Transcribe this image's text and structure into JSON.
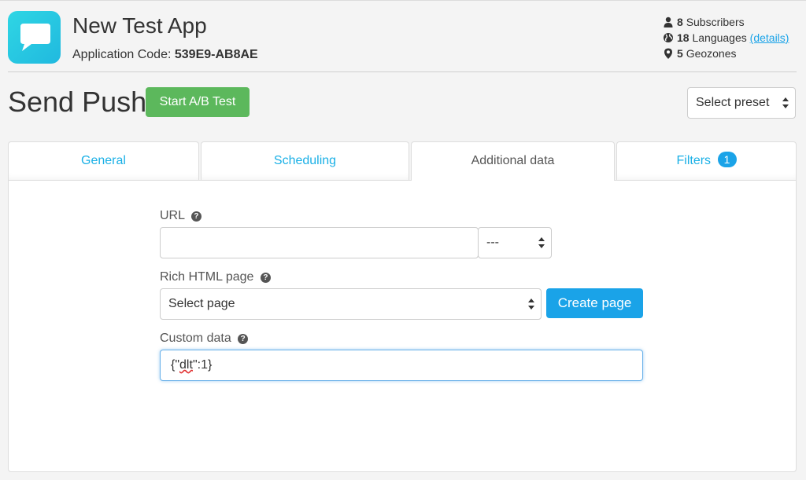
{
  "app": {
    "name": "New Test App",
    "code_label": "Application Code:",
    "code": "539E9-AB8AE",
    "icon": "chat-bubble-icon",
    "icon_color": "#22c1e2"
  },
  "stats": {
    "subscribers_count": "8",
    "subscribers_label": "Subscribers",
    "languages_count": "18",
    "languages_label": "Languages",
    "details_link": "(details)",
    "geozones_count": "5",
    "geozones_label": "Geozones"
  },
  "page": {
    "title": "Send Push",
    "ab_button": "Start A/B Test",
    "preset_select": "Select preset"
  },
  "tabs": [
    {
      "label": "General",
      "active": false
    },
    {
      "label": "Scheduling",
      "active": false
    },
    {
      "label": "Additional data",
      "active": true
    },
    {
      "label": "Filters",
      "active": false,
      "badge": "1"
    }
  ],
  "form": {
    "url_label": "URL",
    "url_value": "",
    "url_select": "---",
    "rich_label": "Rich HTML page",
    "rich_select": "Select page",
    "create_button": "Create page",
    "custom_label": "Custom data",
    "custom_prefix": "{\"",
    "custom_word": "dlt",
    "custom_suffix": "\":1}"
  },
  "colors": {
    "accent": "#1aa3e8",
    "green_button": "#5cb85c",
    "link": "#1ab0e6"
  }
}
